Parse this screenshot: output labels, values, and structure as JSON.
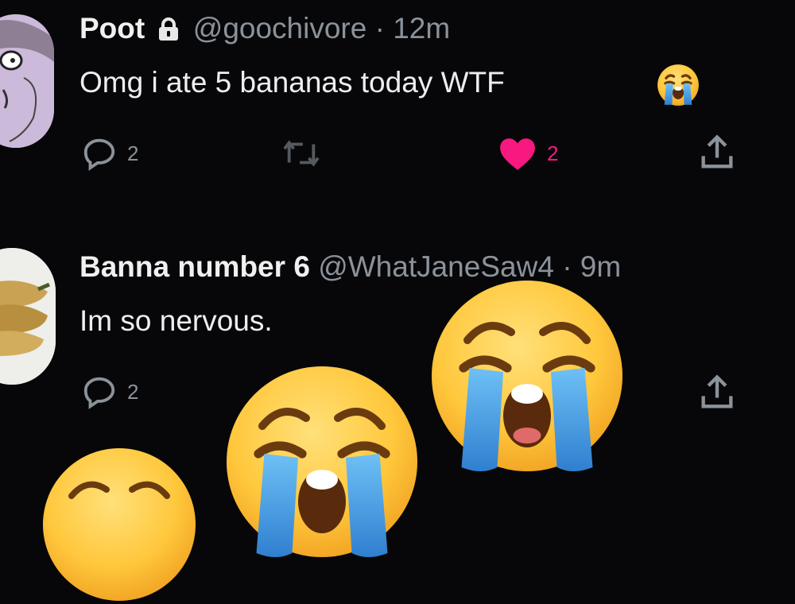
{
  "tweets": [
    {
      "display_name": "Poot",
      "handle": "@goochivore",
      "separator": "·",
      "time": "12m",
      "text": "Omg i ate 5 bananas today WTF",
      "reply_count": "2",
      "like_count": "2",
      "liked": true,
      "locked": true
    },
    {
      "display_name": "Banna number 6",
      "handle": "@WhatJaneSaw4",
      "separator": "·",
      "time": "9m",
      "text": "Im so nervous.",
      "reply_count": "2"
    }
  ],
  "icons": {
    "reply": "reply-icon",
    "retweet": "retweet-icon",
    "like": "heart-icon",
    "share": "share-icon",
    "lock": "lock-icon",
    "emoji": "loudly-crying-face"
  },
  "colors": {
    "background": "#070709",
    "like": "#f91880",
    "secondary_text": "#8b9299",
    "emoji_face": "#ffc83d",
    "tears": "#4aa3e8"
  }
}
